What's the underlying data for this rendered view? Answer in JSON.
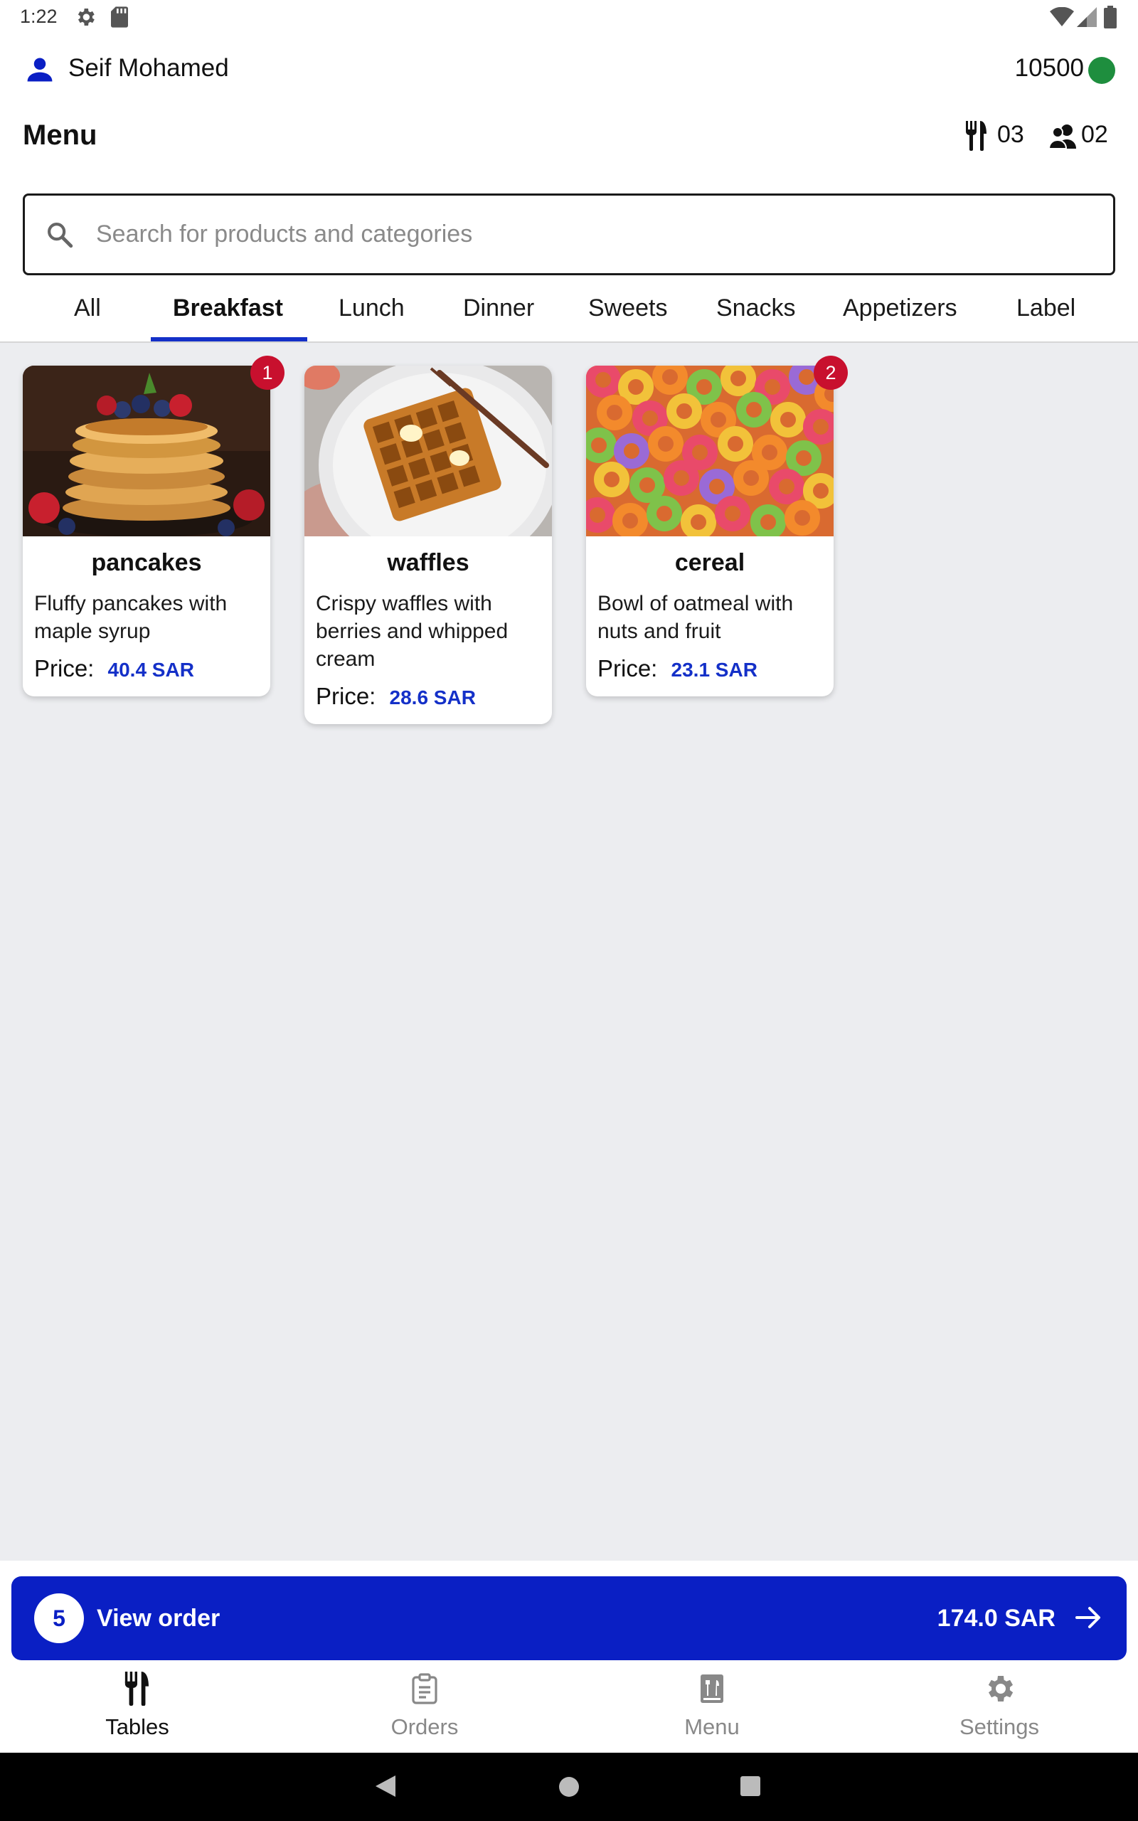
{
  "status_bar": {
    "time": "1:22"
  },
  "user": {
    "name": "Seif Mohamed",
    "points": "10500"
  },
  "header": {
    "title": "Menu",
    "tables_count": "03",
    "guests_count": "02"
  },
  "search": {
    "placeholder": "Search for products and categories"
  },
  "tabs": [
    {
      "label": "All"
    },
    {
      "label": "Breakfast",
      "active": true
    },
    {
      "label": "Lunch"
    },
    {
      "label": "Dinner"
    },
    {
      "label": "Sweets"
    },
    {
      "label": "Snacks"
    },
    {
      "label": "Appetizers"
    },
    {
      "label": "Label"
    }
  ],
  "products": [
    {
      "name": "pancakes",
      "description": "Fluffy pancakes with maple syrup",
      "price_label": "Price:",
      "price": "40.4 SAR",
      "quantity": "1"
    },
    {
      "name": "waffles",
      "description": "Crispy waffles with berries and whipped cream",
      "price_label": "Price:",
      "price": "28.6 SAR"
    },
    {
      "name": "cereal",
      "description": "Bowl of oatmeal with nuts and fruit",
      "price_label": "Price:",
      "price": "23.1 SAR",
      "quantity": "2"
    }
  ],
  "order": {
    "count": "5",
    "label": "View order",
    "total": "174.0 SAR"
  },
  "bottom_nav": [
    {
      "label": "Tables",
      "icon": "fork-knife-icon",
      "active": true
    },
    {
      "label": "Orders",
      "icon": "clipboard-icon"
    },
    {
      "label": "Menu",
      "icon": "menu-book-icon"
    },
    {
      "label": "Settings",
      "icon": "gear-icon"
    }
  ],
  "colors": {
    "accent": "#0a1fc4",
    "badge": "#c8102e",
    "online": "#1e8e3e",
    "background": "#ecedf0"
  }
}
